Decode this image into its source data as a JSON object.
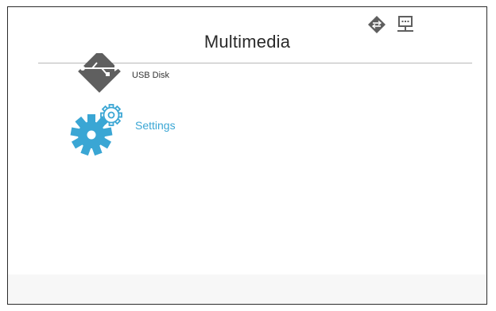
{
  "header": {
    "title": "Multimedia",
    "status_icons": [
      "network-icon",
      "display-icon"
    ]
  },
  "menu": {
    "items": [
      {
        "label": "USB Disk",
        "icon": "usb-disk-icon",
        "selected": false
      },
      {
        "label": "Settings",
        "icon": "gear-icon",
        "selected": true
      }
    ]
  },
  "colors": {
    "title": "#2a2a2a",
    "icon_gray": "#5f5f5f",
    "accent_blue": "#3aa6d4",
    "rule": "#b8b8b8",
    "border": "#2b2b2b"
  }
}
